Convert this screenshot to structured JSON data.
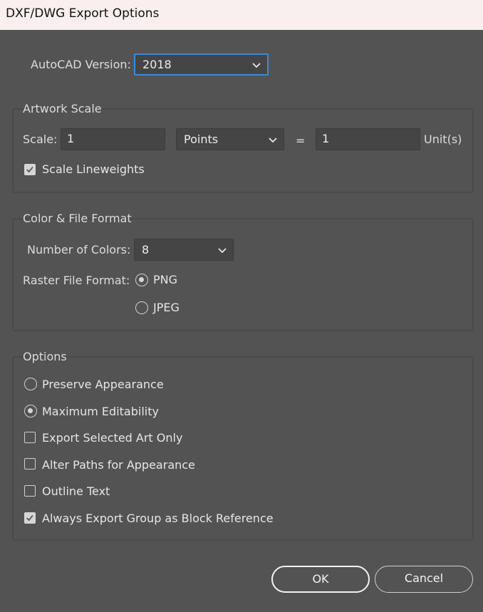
{
  "window": {
    "title": "DXF/DWG Export Options"
  },
  "autocad": {
    "label": "AutoCAD Version:",
    "value": "2018"
  },
  "artwork_scale": {
    "title": "Artwork Scale",
    "scale_label": "Scale:",
    "scale_value": "1",
    "units_value": "Points",
    "equals": "=",
    "unit_value": "1",
    "unit_label": "Unit(s)",
    "scale_lineweights": {
      "label": "Scale Lineweights",
      "checked": true
    }
  },
  "color_format": {
    "title": "Color & File Format",
    "colors_label": "Number of Colors:",
    "colors_value": "8",
    "raster_label": "Raster File Format:",
    "png_label": "PNG",
    "jpeg_label": "JPEG",
    "selected": "PNG"
  },
  "options": {
    "title": "Options",
    "preserve": "Preserve Appearance",
    "maximum": "Maximum Editability",
    "export_selected": "Export Selected Art Only",
    "alter_paths": "Alter Paths for Appearance",
    "outline_text": "Outline Text",
    "always_block": "Always Export Group as Block Reference",
    "selected_mode": "Maximum Editability",
    "checked": [
      "Always Export Group as Block Reference"
    ]
  },
  "buttons": {
    "ok": "OK",
    "cancel": "Cancel"
  },
  "colors": {
    "background": "#535353",
    "focus": "#3b8ad8",
    "titlebar": "#f9efee"
  },
  "icons": [
    "chevron-down-icon",
    "checkmark-icon"
  ]
}
